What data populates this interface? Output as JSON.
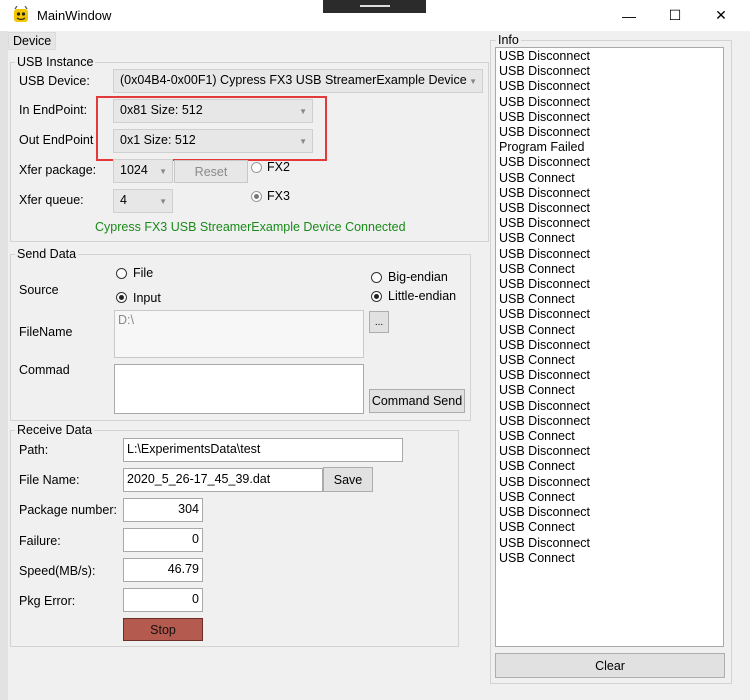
{
  "window": {
    "title": "MainWindow",
    "minimize_glyph": "—",
    "maximize_glyph": "☐",
    "close_glyph": "✕"
  },
  "menu": {
    "device": "Device"
  },
  "usb_instance": {
    "title": "USB Instance",
    "device_label": "USB Device:",
    "device_value": "(0x04B4-0x00F1) Cypress FX3 USB StreamerExample Device",
    "in_endpoint_label": "In EndPoint:",
    "in_endpoint_value": "0x81 Size: 512",
    "out_endpoint_label": "Out EndPoint",
    "out_endpoint_value": "0x1 Size: 512",
    "xfer_package_label": "Xfer package:",
    "xfer_package_value": "1024",
    "reset_label": "Reset",
    "xfer_queue_label": "Xfer queue:",
    "xfer_queue_value": "4",
    "fx2_label": "FX2",
    "fx3_label": "FX3",
    "status_text": "Cypress FX3 USB StreamerExample Device Connected",
    "status_color": "#1a8a1a"
  },
  "send_data": {
    "title": "Send Data",
    "source_label": "Source",
    "file_option": "File",
    "input_option": "Input",
    "big_endian": "Big-endian",
    "little_endian": "Little-endian",
    "filename_label": "FileName",
    "filename_value": "D:\\",
    "browse_label": "...",
    "command_label": "Commad",
    "command_value": "",
    "command_send_label": "Command Send"
  },
  "receive_data": {
    "title": "Receive Data",
    "path_label": "Path:",
    "path_value": "L:\\ExperimentsData\\test",
    "file_name_label": "File Name:",
    "file_name_value": "2020_5_26-17_45_39.dat",
    "save_label": "Save",
    "package_number_label": "Package number:",
    "package_number_value": "304",
    "failure_label": "Failure:",
    "failure_value": "0",
    "speed_label": "Speed(MB/s):",
    "speed_value": "46.79",
    "pkg_error_label": "Pkg Error:",
    "pkg_error_value": "0",
    "stop_label": "Stop",
    "stop_color": "#b55a4e"
  },
  "info": {
    "title": "Info",
    "clear_label": "Clear",
    "messages": [
      "USB Disconnect",
      "USB Disconnect",
      "USB Disconnect",
      "USB Disconnect",
      "USB Disconnect",
      "USB Disconnect",
      "Program Failed",
      "USB Disconnect",
      "USB Connect",
      "USB Disconnect",
      "USB Disconnect",
      "USB Disconnect",
      "USB Connect",
      "USB Disconnect",
      "USB Connect",
      "USB Disconnect",
      "USB Connect",
      "USB Disconnect",
      "USB Connect",
      "USB Disconnect",
      "USB Connect",
      "USB Disconnect",
      "USB Connect",
      "USB Disconnect",
      "USB Disconnect",
      "USB Connect",
      "USB Disconnect",
      "USB Connect",
      "USB Disconnect",
      "USB Connect",
      "USB Disconnect",
      "USB Connect",
      "USB Disconnect",
      "USB Connect"
    ]
  },
  "colors": {
    "highlight_box": "#e23a3a"
  }
}
